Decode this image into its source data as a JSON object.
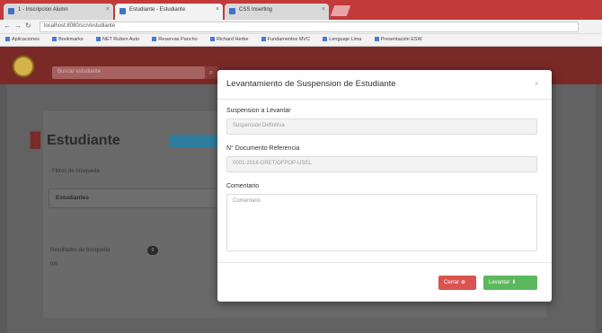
{
  "browser": {
    "tabs": [
      {
        "label": "1 - Inscripcion Alumn",
        "active": false
      },
      {
        "label": "Estudiante - Estudiante",
        "active": true
      },
      {
        "label": "CSS Inserting",
        "active": false
      }
    ],
    "url": "localhost:8080/scn/estudiante",
    "bookmarks": [
      "Aplicaciones",
      "Bookmarks",
      "NET Ruben Auto",
      "Reservas Pancho",
      "Richard Herbe",
      "Fundamentos MVC",
      "Lenguaje Lima",
      "Presentación ESW"
    ]
  },
  "header": {
    "search_placeholder": "Buscar estudiante"
  },
  "page": {
    "title": "Estudiante",
    "filter_label": "Filtros de búsqueda",
    "row_label": "Estudiantes",
    "results_label": "Resultados de búsqueda",
    "results_count": "0",
    "results_value": "0/0"
  },
  "modal": {
    "title": "Levantamiento de Suspension de Estudiante",
    "close_symbol": "×",
    "fields": [
      {
        "label": "Suspension a Levantar",
        "value": "Suspension Definitiva"
      },
      {
        "label": "N° Documento Referencia",
        "value": "0001-2016-GRET/OFPOP-USEL"
      },
      {
        "label": "Comentario",
        "placeholder": "Comentario"
      }
    ],
    "btn_close": "Cerrar",
    "btn_close_icon": "⊗",
    "btn_submit": "Levantar",
    "btn_submit_icon": "⬇"
  },
  "colors": {
    "header": "#7a2a26",
    "close_button": "#d9534f",
    "submit_button": "#5cb85c"
  }
}
